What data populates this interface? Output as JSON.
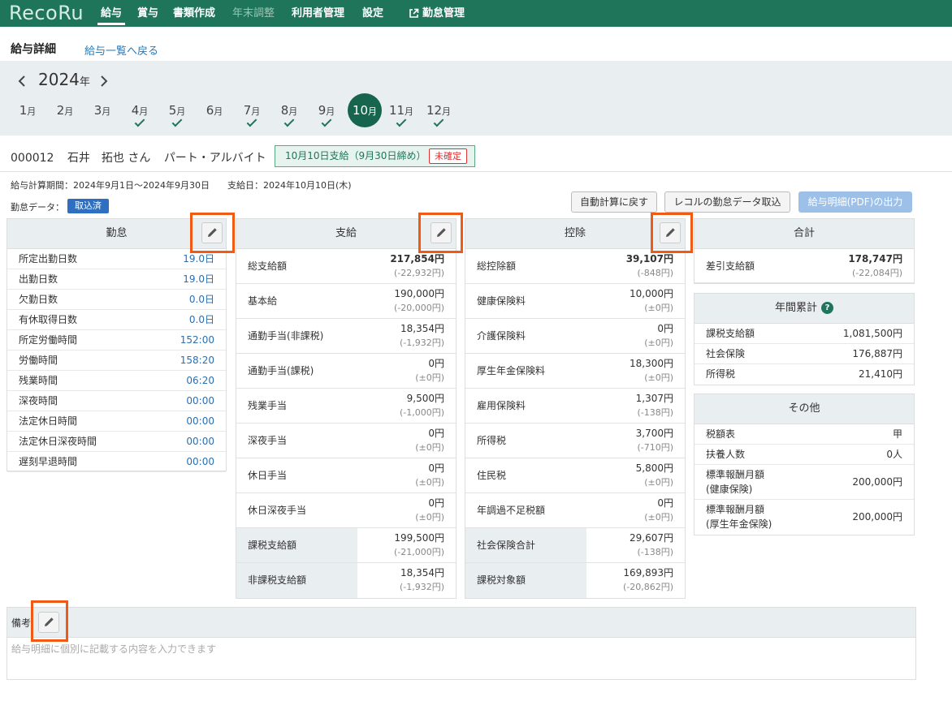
{
  "app": {
    "logo": "RecoRu"
  },
  "nav": [
    {
      "label": "給与",
      "active": true
    },
    {
      "label": "賞与"
    },
    {
      "label": "書類作成"
    },
    {
      "label": "年末調整",
      "disabled": true
    },
    {
      "label": "利用者管理"
    },
    {
      "label": "設定"
    },
    {
      "label": "勤怠管理",
      "external": true
    }
  ],
  "page": {
    "title": "給与詳細",
    "back_link": "給与一覧へ戻る"
  },
  "year": {
    "value": "2024",
    "unit": "年"
  },
  "months": [
    {
      "num": "1",
      "unit": "月",
      "done": false
    },
    {
      "num": "2",
      "unit": "月",
      "done": false
    },
    {
      "num": "3",
      "unit": "月",
      "done": false
    },
    {
      "num": "4",
      "unit": "月",
      "done": true
    },
    {
      "num": "5",
      "unit": "月",
      "done": true
    },
    {
      "num": "6",
      "unit": "月",
      "done": false
    },
    {
      "num": "7",
      "unit": "月",
      "done": true
    },
    {
      "num": "8",
      "unit": "月",
      "done": true
    },
    {
      "num": "9",
      "unit": "月",
      "done": true
    },
    {
      "num": "10",
      "unit": "月",
      "done": false,
      "selected": true
    },
    {
      "num": "11",
      "unit": "月",
      "done": true
    },
    {
      "num": "12",
      "unit": "月",
      "done": true
    }
  ],
  "employee": {
    "id": "000012",
    "name": "石井　拓也 さん",
    "type": "パート・アルバイト"
  },
  "pay_status": {
    "text": "10月10日支給（9月30日締め）",
    "tag": "未確定"
  },
  "period": {
    "calc": "給与計算期間：2024年9月1日～2024年9月30日",
    "payday": "支給日：2024年10月10日(木)"
  },
  "attendance_data": {
    "label": "勤怠データ：",
    "badge": "取込済"
  },
  "buttons": {
    "reset": "自動計算に戻す",
    "import": "レコルの勤怠データ取込",
    "pdf": "給与明細(PDF)の出力"
  },
  "kintai": {
    "title": "勤怠",
    "rows": [
      {
        "label": "所定出勤日数",
        "value": "19.0日"
      },
      {
        "label": "出勤日数",
        "value": "19.0日"
      },
      {
        "label": "欠勤日数",
        "value": "0.0日"
      },
      {
        "label": "有休取得日数",
        "value": "0.0日"
      },
      {
        "label": "所定労働時間",
        "value": "152:00"
      },
      {
        "label": "労働時間",
        "value": "158:20"
      },
      {
        "label": "残業時間",
        "value": "06:20"
      },
      {
        "label": "深夜時間",
        "value": "00:00"
      },
      {
        "label": "法定休日時間",
        "value": "00:00"
      },
      {
        "label": "法定休日深夜時間",
        "value": "00:00"
      },
      {
        "label": "遅刻早退時間",
        "value": "00:00"
      }
    ]
  },
  "shikyu": {
    "title": "支給",
    "rows": [
      {
        "label": "総支給額",
        "value": "217,854円",
        "diff": "(-22,932円)",
        "bold": true
      },
      {
        "label": "基本給",
        "value": "190,000円",
        "diff": "(-20,000円)"
      },
      {
        "label": "通勤手当(非課税)",
        "value": "18,354円",
        "diff": "(-1,932円)"
      },
      {
        "label": "通勤手当(課税)",
        "value": "0円",
        "diff": "(±0円)"
      },
      {
        "label": "残業手当",
        "value": "9,500円",
        "diff": "(-1,000円)"
      },
      {
        "label": "深夜手当",
        "value": "0円",
        "diff": "(±0円)"
      },
      {
        "label": "休日手当",
        "value": "0円",
        "diff": "(±0円)"
      },
      {
        "label": "休日深夜手当",
        "value": "0円",
        "diff": "(±0円)"
      },
      {
        "label": "課税支給額",
        "value": "199,500円",
        "diff": "(-21,000円)",
        "gray": true
      },
      {
        "label": "非課税支給額",
        "value": "18,354円",
        "diff": "(-1,932円)",
        "gray": true
      }
    ]
  },
  "kojo": {
    "title": "控除",
    "rows": [
      {
        "label": "総控除額",
        "value": "39,107円",
        "diff": "(-848円)",
        "bold": true
      },
      {
        "label": "健康保険料",
        "value": "10,000円",
        "diff": "(±0円)"
      },
      {
        "label": "介護保険料",
        "value": "0円",
        "diff": "(±0円)"
      },
      {
        "label": "厚生年金保険料",
        "value": "18,300円",
        "diff": "(±0円)"
      },
      {
        "label": "雇用保険料",
        "value": "1,307円",
        "diff": "(-138円)"
      },
      {
        "label": "所得税",
        "value": "3,700円",
        "diff": "(-710円)"
      },
      {
        "label": "住民税",
        "value": "5,800円",
        "diff": "(±0円)"
      },
      {
        "label": "年調過不足税額",
        "value": "0円",
        "diff": "(±0円)"
      },
      {
        "label": "社会保険合計",
        "value": "29,607円",
        "diff": "(-138円)",
        "gray": true
      },
      {
        "label": "課税対象額",
        "value": "169,893円",
        "diff": "(-20,862円)",
        "gray": true
      }
    ]
  },
  "gokei": {
    "title": "合計",
    "label": "差引支給額",
    "value": "178,747円",
    "diff": "(-22,084円)"
  },
  "nenkan": {
    "title": "年間累計",
    "rows": [
      {
        "label": "課税支給額",
        "value": "1,081,500円"
      },
      {
        "label": "社会保険",
        "value": "176,887円"
      },
      {
        "label": "所得税",
        "value": "21,410円"
      }
    ]
  },
  "sonota": {
    "title": "その他",
    "rows": [
      {
        "label": "税額表",
        "value": "甲"
      },
      {
        "label": "扶養人数",
        "value": "0人"
      },
      {
        "label": "標準報酬月額",
        "label2": "(健康保険)",
        "value": "200,000円"
      },
      {
        "label": "標準報酬月額",
        "label2": "(厚生年金保険)",
        "value": "200,000円"
      }
    ]
  },
  "remarks": {
    "title": "備考",
    "placeholder": "給与明細に個別に記載する内容を入力できます"
  },
  "colors": {
    "header": "#1f7559",
    "highlight": "#f05a14",
    "link": "#2a7ab9"
  }
}
